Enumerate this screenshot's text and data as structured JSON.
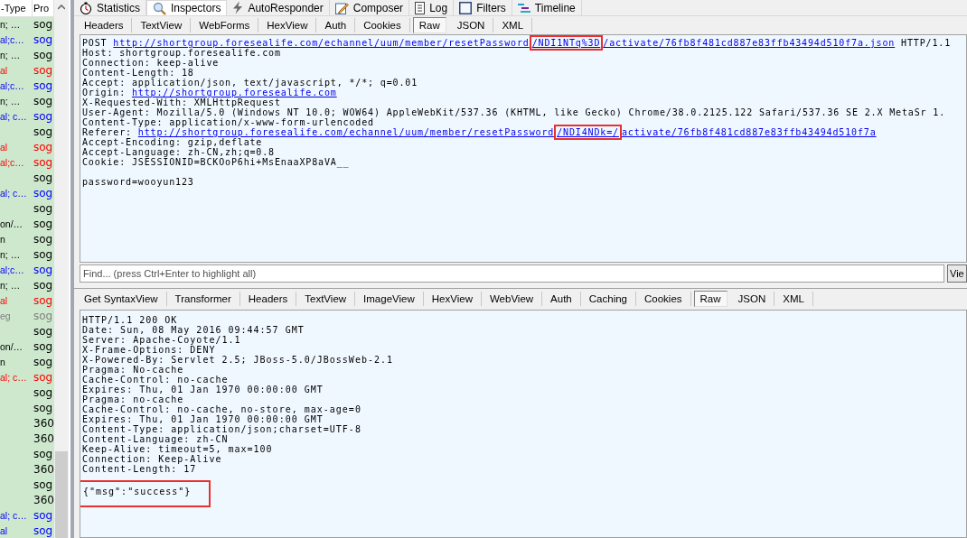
{
  "sessions": {
    "columns": [
      "-Type",
      "Pro"
    ],
    "rows": [
      {
        "content_type": "n; …",
        "process": "sog",
        "color": "#000000"
      },
      {
        "content_type": "al;c…",
        "process": "sog",
        "color": "#0000ff"
      },
      {
        "content_type": "n; …",
        "process": "sog",
        "color": "#000000"
      },
      {
        "content_type": "al",
        "process": "sog",
        "color": "#ff0000"
      },
      {
        "content_type": "al;c…",
        "process": "sog",
        "color": "#0000ff"
      },
      {
        "content_type": "n; …",
        "process": "sog",
        "color": "#000000"
      },
      {
        "content_type": "al; c…",
        "process": "sog",
        "color": "#0000ff"
      },
      {
        "process": "sog",
        "color": "#000000"
      },
      {
        "content_type": "al",
        "process": "sog",
        "color": "#ff0000"
      },
      {
        "content_type": "al;c…",
        "process": "sog",
        "color": "#ff0000"
      },
      {
        "process": "sog",
        "color": "#000000"
      },
      {
        "content_type": "al; c…",
        "process": "sog",
        "color": "#0000ff"
      },
      {
        "process": "sog",
        "color": "#000000"
      },
      {
        "content_type": "on/…",
        "process": "sog",
        "color": "#000000"
      },
      {
        "content_type": "n",
        "process": "sog",
        "color": "#000000"
      },
      {
        "content_type": "n; …",
        "process": "sog",
        "color": "#000000"
      },
      {
        "content_type": "al;c…",
        "process": "sog",
        "color": "#0000ff"
      },
      {
        "content_type": "n; …",
        "process": "sog",
        "color": "#000000"
      },
      {
        "content_type": "al",
        "process": "sog",
        "color": "#ff0000"
      },
      {
        "content_type": "eg",
        "process": "sog",
        "color": "#808080"
      },
      {
        "process": "sog",
        "color": "#000000"
      },
      {
        "content_type": "on/…",
        "process": "sog",
        "color": "#000000"
      },
      {
        "content_type": "n",
        "process": "sog",
        "color": "#000000"
      },
      {
        "content_type": "al; c…",
        "process": "sog",
        "color": "#ff0000"
      },
      {
        "process": "sog",
        "color": "#000000"
      },
      {
        "process": "sog",
        "color": "#000000"
      },
      {
        "process": "360",
        "color": "#000000"
      },
      {
        "process": "360",
        "color": "#000000"
      },
      {
        "process": "sog",
        "color": "#000000"
      },
      {
        "process": "360",
        "color": "#000000"
      },
      {
        "process": "sog",
        "color": "#000000"
      },
      {
        "process": "360",
        "color": "#000000"
      },
      {
        "content_type": "al; c…",
        "process": "sog",
        "color": "#0000ff"
      },
      {
        "content_type": "al",
        "process": "sog",
        "color": "#0000ff"
      }
    ]
  },
  "main_tabs": [
    {
      "label": "Statistics",
      "selected": false
    },
    {
      "label": "Inspectors",
      "selected": true
    },
    {
      "label": "AutoResponder",
      "selected": false
    },
    {
      "label": "Composer",
      "selected": false
    },
    {
      "label": "Log",
      "selected": false
    },
    {
      "label": "Filters",
      "selected": false
    },
    {
      "label": "Timeline",
      "selected": false
    }
  ],
  "request": {
    "tabs": [
      {
        "label": "Headers",
        "selected": false
      },
      {
        "label": "TextView",
        "selected": false
      },
      {
        "label": "WebForms",
        "selected": false
      },
      {
        "label": "HexView",
        "selected": false
      },
      {
        "label": "Auth",
        "selected": false
      },
      {
        "label": "Cookies",
        "selected": false
      },
      {
        "label": "Raw",
        "selected": true
      },
      {
        "label": "JSON",
        "selected": false
      },
      {
        "label": "XML",
        "selected": false
      }
    ],
    "lines": [
      [
        {
          "text": "POST ",
          "kind": "text"
        },
        {
          "text": "http://shortgroup.foresealife.com/echannel/uum/member/resetPassword",
          "kind": "link"
        },
        {
          "text": "/NDI1NTq%3D",
          "kind": "highlighted_link"
        },
        {
          "text": "/activate/76fb8f481cd887e83ffb43494d510f7a.json",
          "kind": "link"
        },
        {
          "text": " HTTP/1.1",
          "kind": "text"
        }
      ],
      "Host: shortgroup.foresealife.com",
      "Connection: keep-alive",
      "Content-Length: 18",
      "Accept: application/json, text/javascript, */*; q=0.01",
      [
        {
          "text": "Origin: ",
          "kind": "text"
        },
        {
          "text": "http://shortgroup.foresealife.com",
          "kind": "link"
        }
      ],
      "X-Requested-With: XMLHttpRequest",
      "User-Agent: Mozilla/5.0 (Windows NT 10.0; WOW64) AppleWebKit/537.36 (KHTML, like Gecko) Chrome/38.0.2125.122 Safari/537.36 SE 2.X MetaSr 1.",
      "Content-Type: application/x-www-form-urlencoded",
      [
        {
          "text": "Referer: ",
          "kind": "text"
        },
        {
          "text": "http://shortgroup.foresealife.com/echannel/uum/member/resetPassword",
          "kind": "link"
        },
        {
          "text": "/NDI4NDk=/",
          "kind": "highlighted_link"
        },
        {
          "text": "activate/76fb8f481cd887e83ffb43494d510f7a",
          "kind": "link"
        }
      ],
      "Accept-Encoding: gzip,deflate",
      "Accept-Language: zh-CN,zh;q=0.8",
      "Cookie: JSESSIONID=BCKOoP6hi+MsEnaaXP8aVA__"
    ],
    "body": "password=wooyun123",
    "find_placeholder": "Find... (press Ctrl+Enter to highlight all)",
    "view_button": "Vie"
  },
  "response": {
    "tabs": [
      {
        "label": "Get SyntaxView",
        "selected": false
      },
      {
        "label": "Transformer",
        "selected": false
      },
      {
        "label": "Headers",
        "selected": false
      },
      {
        "label": "TextView",
        "selected": false
      },
      {
        "label": "ImageView",
        "selected": false
      },
      {
        "label": "HexView",
        "selected": false
      },
      {
        "label": "WebView",
        "selected": false
      },
      {
        "label": "Auth",
        "selected": false
      },
      {
        "label": "Caching",
        "selected": false
      },
      {
        "label": "Cookies",
        "selected": false
      },
      {
        "label": "Raw",
        "selected": true
      },
      {
        "label": "JSON",
        "selected": false
      },
      {
        "label": "XML",
        "selected": false
      }
    ],
    "lines": [
      "HTTP/1.1 200 OK",
      "Date: Sun, 08 May 2016 09:44:57 GMT",
      "Server: Apache-Coyote/1.1",
      "X-Frame-Options: DENY",
      "X-Powered-By: Servlet 2.5; JBoss-5.0/JBossWeb-2.1",
      "Pragma: No-cache",
      "Cache-Control: no-cache",
      "Expires: Thu, 01 Jan 1970 00:00:00 GMT",
      "Pragma: no-cache",
      "Cache-Control: no-cache, no-store, max-age=0",
      "Expires: Thu, 01 Jan 1970 00:00:00 GMT",
      "Content-Type: application/json;charset=UTF-8",
      "Content-Language: zh-CN",
      "Keep-Alive: timeout=5, max=100",
      "Connection: Keep-Alive",
      "Content-Length: 17"
    ],
    "body": {
      "text": "{\"msg\":\"success\"}",
      "highlighted": true
    }
  }
}
